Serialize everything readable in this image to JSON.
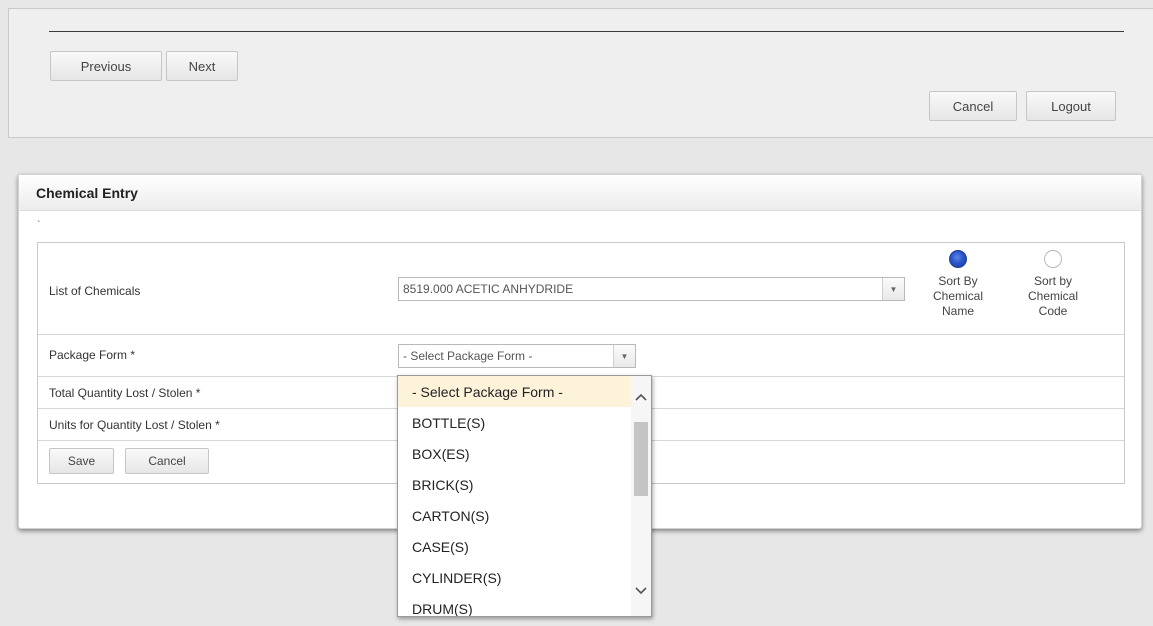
{
  "nav": {
    "previous_label": "Previous",
    "next_label": "Next",
    "cancel_label": "Cancel",
    "logout_label": "Logout"
  },
  "panel": {
    "title": "Chemical Entry",
    "tick": "`"
  },
  "form": {
    "chemicals_label": "List of Chemicals",
    "chemicals_value": "8519.000 ACETIC ANHYDRIDE",
    "sort_name_label": "Sort By Chemical Name",
    "sort_code_label": "Sort by Chemical Code",
    "sort_selected": "name",
    "package_label": "Package Form *",
    "package_value": "- Select Package Form -",
    "quantity_label": "Total Quantity Lost / Stolen *",
    "units_label": "Units for Quantity Lost / Stolen *",
    "save_label": "Save",
    "cancel_label": "Cancel"
  },
  "dropdown": {
    "options": [
      "- Select Package Form -",
      "BOTTLE(S)",
      "BOX(ES)",
      "BRICK(S)",
      "CARTON(S)",
      "CASE(S)",
      "CYLINDER(S)",
      "DRUM(S)"
    ],
    "highlighted": "- Select Package Form -"
  }
}
